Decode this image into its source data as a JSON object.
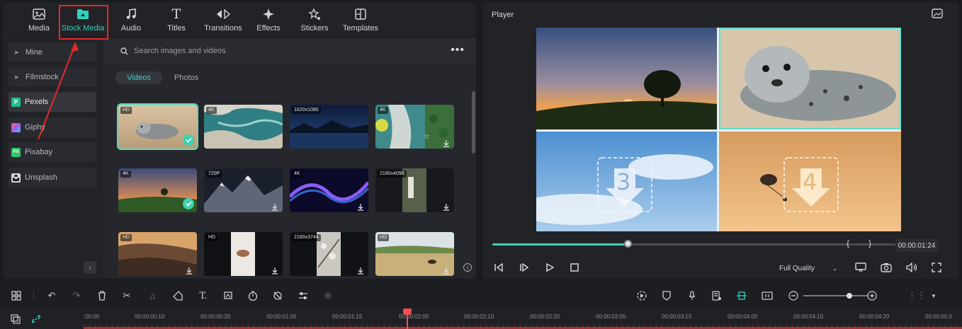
{
  "toolbar": {
    "tabs": [
      {
        "label": "Media",
        "icon": "media-icon"
      },
      {
        "label": "Stock Media",
        "icon": "stock-media-icon",
        "active": true
      },
      {
        "label": "Audio",
        "icon": "music-note-icon"
      },
      {
        "label": "Titles",
        "icon": "text-icon"
      },
      {
        "label": "Transitions",
        "icon": "transitions-icon"
      },
      {
        "label": "Effects",
        "icon": "sparkle-icon"
      },
      {
        "label": "Stickers",
        "icon": "sticker-icon"
      },
      {
        "label": "Templates",
        "icon": "templates-icon"
      }
    ]
  },
  "sidebar": {
    "items": [
      {
        "label": "Mine",
        "type": "folder"
      },
      {
        "label": "Filmstock",
        "type": "folder"
      },
      {
        "label": "Pexels",
        "logo": "P",
        "color": "#1fbf8f",
        "active": true
      },
      {
        "label": "Giphy",
        "logo": "G",
        "color": "#a35cf0"
      },
      {
        "label": "Pixabay",
        "logo": "PX",
        "color": "#2ec66b"
      },
      {
        "label": "Unsplash",
        "logo": "U",
        "color": "#d8d8d8"
      }
    ]
  },
  "search": {
    "placeholder": "Search images and videos"
  },
  "subtabs": {
    "videos": "Videos",
    "photos": "Photos",
    "active": "Videos"
  },
  "grid": [
    {
      "res": "HD",
      "state": "selected"
    },
    {
      "res": "4K",
      "state": "none"
    },
    {
      "res": "1620x1080",
      "state": "none"
    },
    {
      "res": "4K",
      "state": "download"
    },
    {
      "res": "4K",
      "state": "added"
    },
    {
      "res": "720P",
      "state": "download"
    },
    {
      "res": "4K",
      "state": "download"
    },
    {
      "res": "2160x4096",
      "state": "download"
    },
    {
      "res": "HD",
      "state": "download"
    },
    {
      "res": "HD",
      "state": "download"
    },
    {
      "res": "2160x3744",
      "state": "download"
    },
    {
      "res": "HD",
      "state": "download"
    }
  ],
  "player": {
    "title": "Player",
    "time": "00:00:01:24",
    "quality": "Full Quality",
    "progress": 0.33,
    "placeholder_3": "3",
    "placeholder_4": "4"
  },
  "ruler": {
    "labels": [
      ":00:00",
      "00:00:00:10",
      "00:00:00:20",
      "00:00:01:05",
      "00:00:01:15",
      "00:00:02:00",
      "00:00:02:10",
      "00:00:02:20",
      "00:00:03:05",
      "00:00:03:15",
      "00:00:04:00",
      "00:00:04:10",
      "00:00:04:20",
      "00:00:05:0"
    ]
  },
  "colors": {
    "accent": "#3fd1c0",
    "highlight": "#e22a2a",
    "playhead": "#ff4b55"
  }
}
